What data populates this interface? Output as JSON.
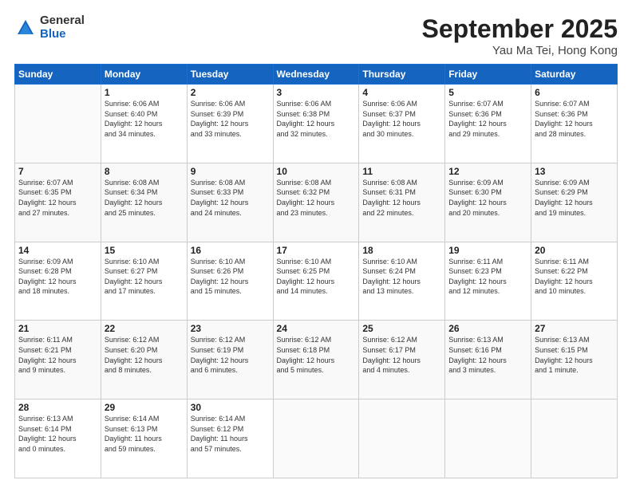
{
  "header": {
    "logo_general": "General",
    "logo_blue": "Blue",
    "title": "September 2025",
    "location": "Yau Ma Tei, Hong Kong"
  },
  "weekdays": [
    "Sunday",
    "Monday",
    "Tuesday",
    "Wednesday",
    "Thursday",
    "Friday",
    "Saturday"
  ],
  "weeks": [
    [
      {
        "day": "",
        "info": ""
      },
      {
        "day": "1",
        "info": "Sunrise: 6:06 AM\nSunset: 6:40 PM\nDaylight: 12 hours\nand 34 minutes."
      },
      {
        "day": "2",
        "info": "Sunrise: 6:06 AM\nSunset: 6:39 PM\nDaylight: 12 hours\nand 33 minutes."
      },
      {
        "day": "3",
        "info": "Sunrise: 6:06 AM\nSunset: 6:38 PM\nDaylight: 12 hours\nand 32 minutes."
      },
      {
        "day": "4",
        "info": "Sunrise: 6:06 AM\nSunset: 6:37 PM\nDaylight: 12 hours\nand 30 minutes."
      },
      {
        "day": "5",
        "info": "Sunrise: 6:07 AM\nSunset: 6:36 PM\nDaylight: 12 hours\nand 29 minutes."
      },
      {
        "day": "6",
        "info": "Sunrise: 6:07 AM\nSunset: 6:36 PM\nDaylight: 12 hours\nand 28 minutes."
      }
    ],
    [
      {
        "day": "7",
        "info": "Sunrise: 6:07 AM\nSunset: 6:35 PM\nDaylight: 12 hours\nand 27 minutes."
      },
      {
        "day": "8",
        "info": "Sunrise: 6:08 AM\nSunset: 6:34 PM\nDaylight: 12 hours\nand 25 minutes."
      },
      {
        "day": "9",
        "info": "Sunrise: 6:08 AM\nSunset: 6:33 PM\nDaylight: 12 hours\nand 24 minutes."
      },
      {
        "day": "10",
        "info": "Sunrise: 6:08 AM\nSunset: 6:32 PM\nDaylight: 12 hours\nand 23 minutes."
      },
      {
        "day": "11",
        "info": "Sunrise: 6:08 AM\nSunset: 6:31 PM\nDaylight: 12 hours\nand 22 minutes."
      },
      {
        "day": "12",
        "info": "Sunrise: 6:09 AM\nSunset: 6:30 PM\nDaylight: 12 hours\nand 20 minutes."
      },
      {
        "day": "13",
        "info": "Sunrise: 6:09 AM\nSunset: 6:29 PM\nDaylight: 12 hours\nand 19 minutes."
      }
    ],
    [
      {
        "day": "14",
        "info": "Sunrise: 6:09 AM\nSunset: 6:28 PM\nDaylight: 12 hours\nand 18 minutes."
      },
      {
        "day": "15",
        "info": "Sunrise: 6:10 AM\nSunset: 6:27 PM\nDaylight: 12 hours\nand 17 minutes."
      },
      {
        "day": "16",
        "info": "Sunrise: 6:10 AM\nSunset: 6:26 PM\nDaylight: 12 hours\nand 15 minutes."
      },
      {
        "day": "17",
        "info": "Sunrise: 6:10 AM\nSunset: 6:25 PM\nDaylight: 12 hours\nand 14 minutes."
      },
      {
        "day": "18",
        "info": "Sunrise: 6:10 AM\nSunset: 6:24 PM\nDaylight: 12 hours\nand 13 minutes."
      },
      {
        "day": "19",
        "info": "Sunrise: 6:11 AM\nSunset: 6:23 PM\nDaylight: 12 hours\nand 12 minutes."
      },
      {
        "day": "20",
        "info": "Sunrise: 6:11 AM\nSunset: 6:22 PM\nDaylight: 12 hours\nand 10 minutes."
      }
    ],
    [
      {
        "day": "21",
        "info": "Sunrise: 6:11 AM\nSunset: 6:21 PM\nDaylight: 12 hours\nand 9 minutes."
      },
      {
        "day": "22",
        "info": "Sunrise: 6:12 AM\nSunset: 6:20 PM\nDaylight: 12 hours\nand 8 minutes."
      },
      {
        "day": "23",
        "info": "Sunrise: 6:12 AM\nSunset: 6:19 PM\nDaylight: 12 hours\nand 6 minutes."
      },
      {
        "day": "24",
        "info": "Sunrise: 6:12 AM\nSunset: 6:18 PM\nDaylight: 12 hours\nand 5 minutes."
      },
      {
        "day": "25",
        "info": "Sunrise: 6:12 AM\nSunset: 6:17 PM\nDaylight: 12 hours\nand 4 minutes."
      },
      {
        "day": "26",
        "info": "Sunrise: 6:13 AM\nSunset: 6:16 PM\nDaylight: 12 hours\nand 3 minutes."
      },
      {
        "day": "27",
        "info": "Sunrise: 6:13 AM\nSunset: 6:15 PM\nDaylight: 12 hours\nand 1 minute."
      }
    ],
    [
      {
        "day": "28",
        "info": "Sunrise: 6:13 AM\nSunset: 6:14 PM\nDaylight: 12 hours\nand 0 minutes."
      },
      {
        "day": "29",
        "info": "Sunrise: 6:14 AM\nSunset: 6:13 PM\nDaylight: 11 hours\nand 59 minutes."
      },
      {
        "day": "30",
        "info": "Sunrise: 6:14 AM\nSunset: 6:12 PM\nDaylight: 11 hours\nand 57 minutes."
      },
      {
        "day": "",
        "info": ""
      },
      {
        "day": "",
        "info": ""
      },
      {
        "day": "",
        "info": ""
      },
      {
        "day": "",
        "info": ""
      }
    ]
  ]
}
